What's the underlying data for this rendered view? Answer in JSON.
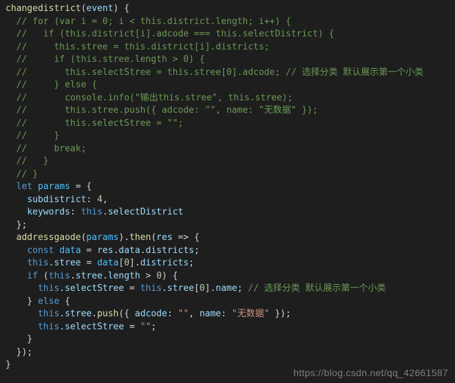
{
  "code": {
    "fn_name": "changedistrict",
    "fn_arg": "event",
    "c1": "// for (var i = 0; i < this.district.length; i++) {",
    "c2": "//   if (this.district[i].adcode === this.selectDistrict) {",
    "c3": "//     this.stree = this.district[i].districts;",
    "c4": "//     if (this.stree.length > 0) {",
    "c5": "//       this.selectStree = this.stree[0].adcode; // 选择分类 默认展示第一个小类",
    "c6": "//     } else {",
    "c7": "//       console.info(\"输出this.stree\", this.stree);",
    "c8": "//       this.stree.push({ adcode: \"\", name: \"无数据\" });",
    "c9": "//       this.selectStree = \"\";",
    "c10": "//     }",
    "c11": "//     break;",
    "c12": "//   }",
    "c13": "// }",
    "kw_let": "let",
    "params_name": "params",
    "subdistrict_key": "subdistrict",
    "subdistrict_val": "4",
    "keywords_key": "keywords",
    "kw_this": "this",
    "selectDistrict": "selectDistrict",
    "addressgaode": "addressgaode",
    "then": "then",
    "res": "res",
    "kw_const": "const",
    "data": "data",
    "res_data": "data",
    "districts": "districts",
    "stree": "stree",
    "zero": "0",
    "kw_if": "if",
    "length": "length",
    "gt": ">",
    "selectStree": "selectStree",
    "name": "name",
    "inline_comment": "// 选择分类 默认展示第一个小类",
    "kw_else": "else",
    "push": "push",
    "adcode": "adcode",
    "empty_str": "\"\"",
    "nodata_str": "\"无数据\""
  },
  "watermark": "https://blog.csdn.net/qq_42661587"
}
